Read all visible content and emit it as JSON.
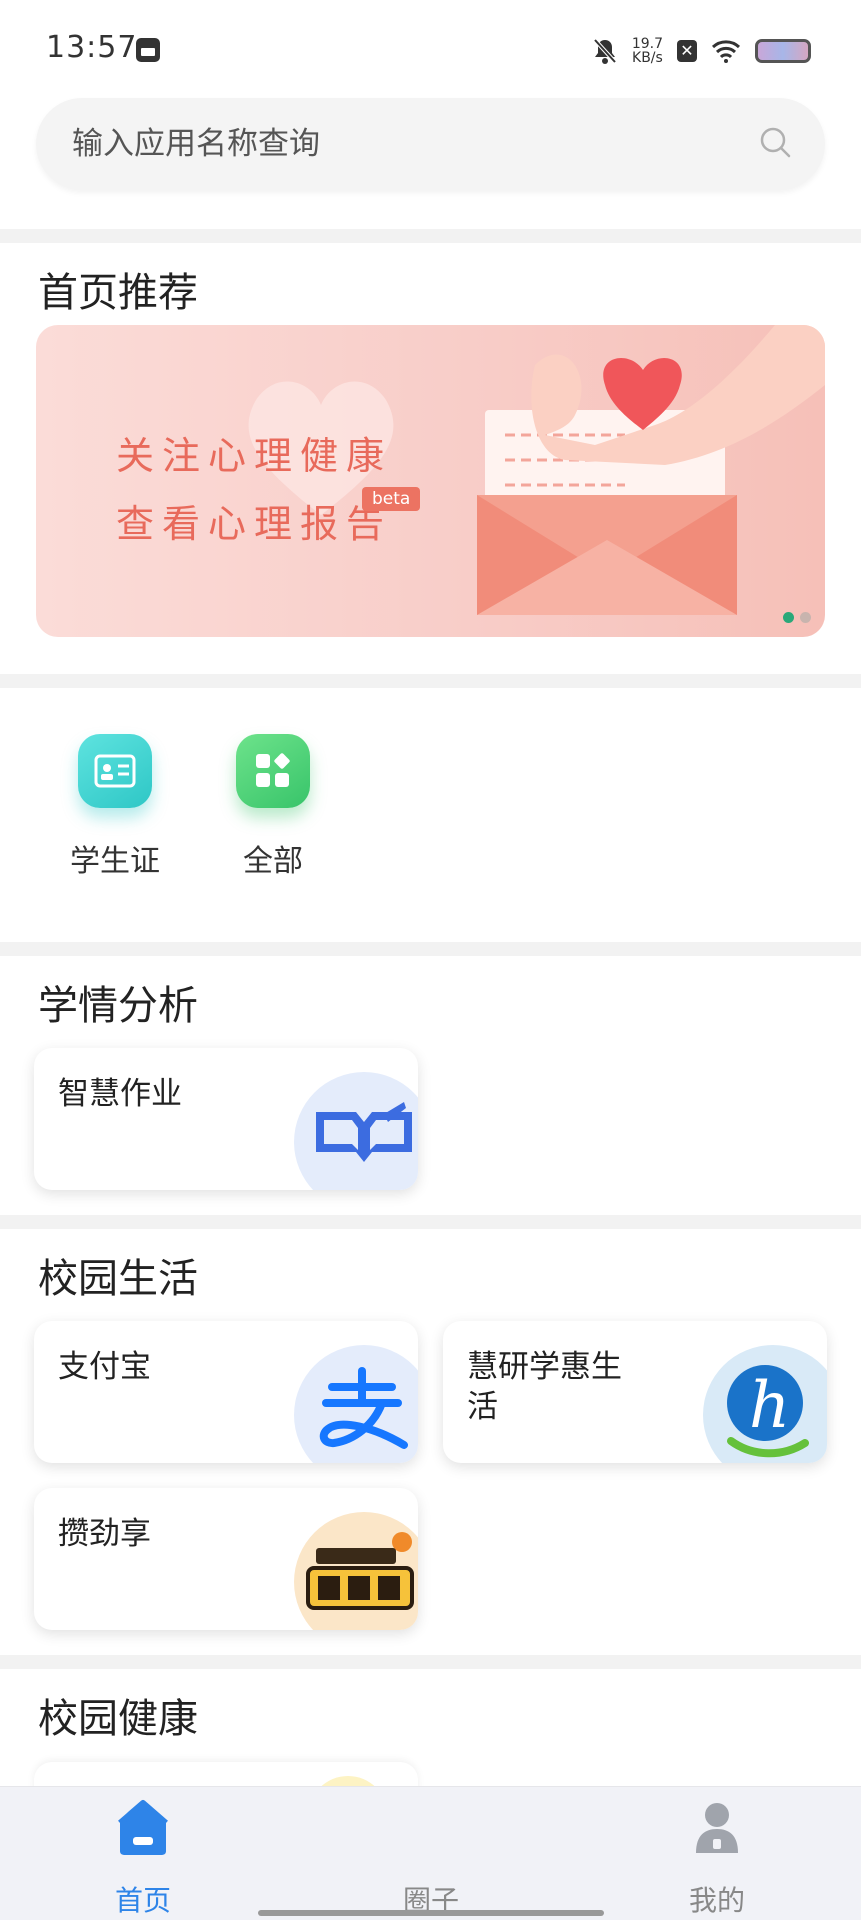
{
  "status_bar": {
    "time": "13:57",
    "net_speed_value": "19.7",
    "net_speed_unit": "KB/s",
    "icons": [
      "notification-icon",
      "mute-bell-icon",
      "sim-icon",
      "wifi-icon",
      "battery-icon"
    ]
  },
  "search": {
    "placeholder": "输入应用名称查询"
  },
  "recommend": {
    "title": "首页推荐",
    "banner": {
      "line1": "关注心理健康",
      "line2": "查看心理报告",
      "badge": "beta",
      "page_count": 2,
      "active_page": 1
    }
  },
  "quick_apps": [
    {
      "label": "学生证",
      "icon": "student-card-icon",
      "color": "#3fd6d0"
    },
    {
      "label": "全部",
      "icon": "grid-apps-icon",
      "color": "#4bd27a"
    }
  ],
  "sections": {
    "analysis": {
      "title": "学情分析",
      "cards": [
        {
          "title": "智慧作业",
          "icon": "book-icon"
        }
      ]
    },
    "campus_life": {
      "title": "校园生活",
      "cards": [
        {
          "title": "支付宝",
          "icon": "alipay-icon"
        },
        {
          "title": "慧研学惠生活",
          "icon": "h-logo-icon"
        },
        {
          "title": "攒劲享",
          "icon": "zanjinxiang-logo-icon"
        }
      ]
    },
    "campus_health": {
      "title": "校园健康"
    }
  },
  "bottom_nav": [
    {
      "label": "首页",
      "icon": "home-icon",
      "active": true
    },
    {
      "label": "圈子",
      "icon": "circle-icon",
      "active": false
    },
    {
      "label": "我的",
      "icon": "user-icon",
      "active": false
    }
  ],
  "colors": {
    "accent": "#2e84e8",
    "banner_text": "#e86a5b",
    "dot_active": "#2aa879"
  }
}
